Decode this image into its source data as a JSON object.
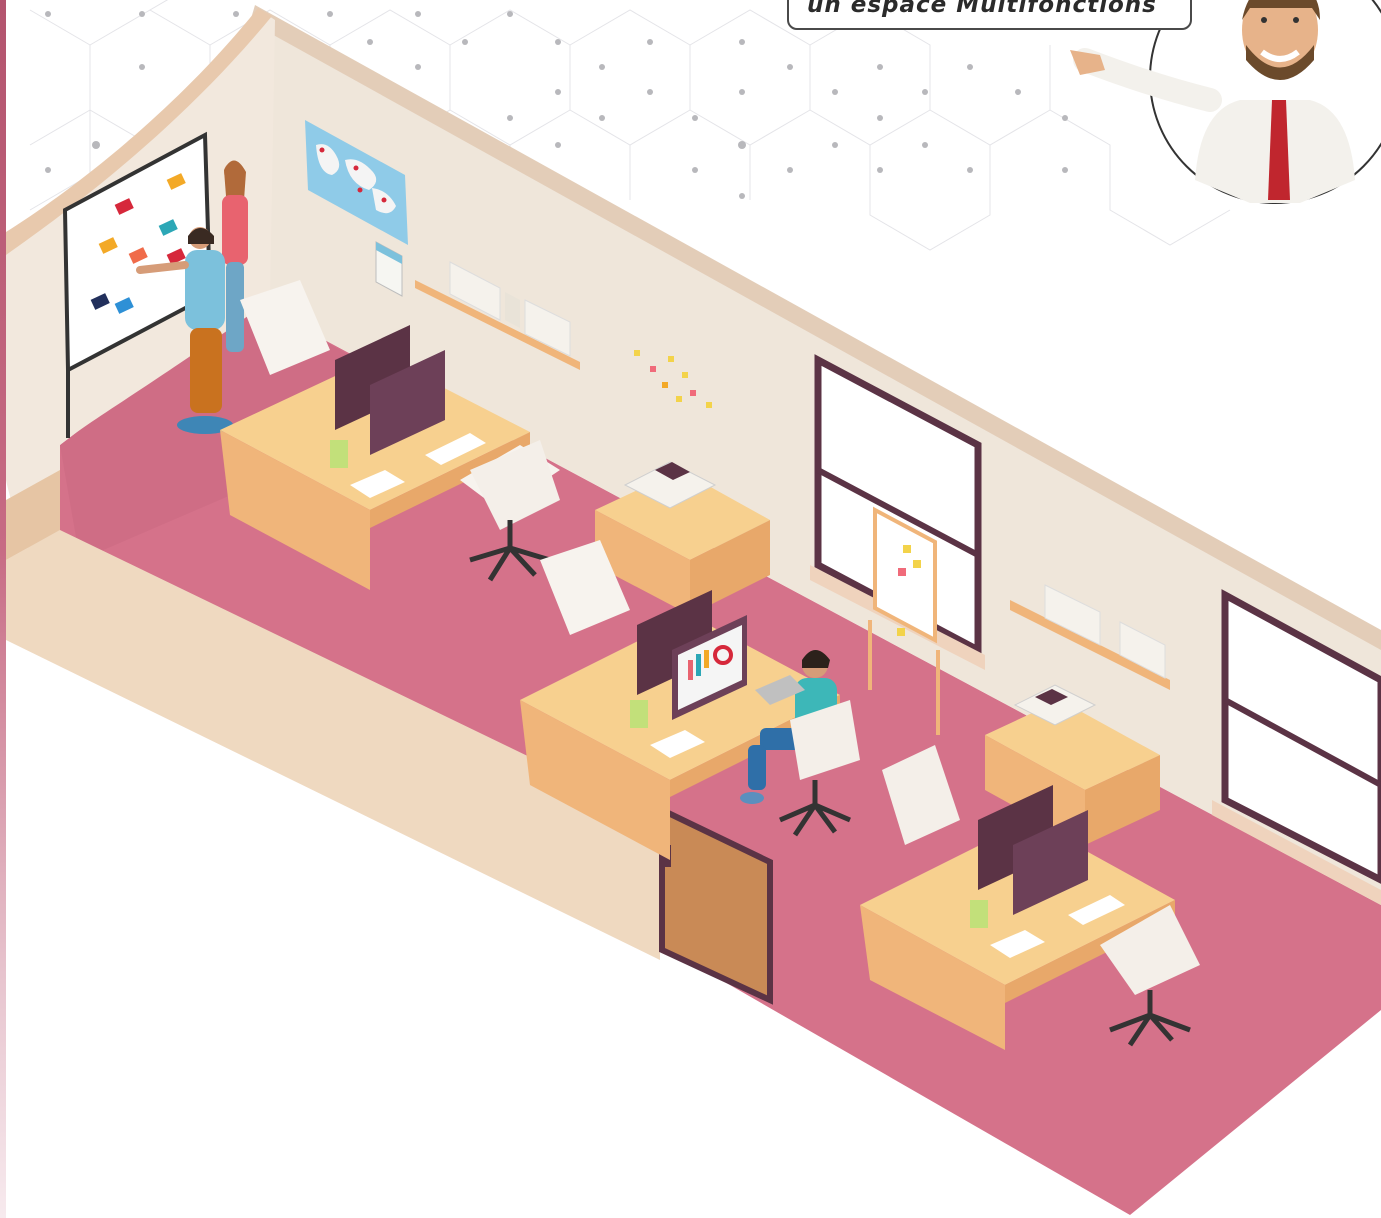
{
  "speech_bubble": {
    "text": "un espace Multifonctions"
  },
  "colors": {
    "floor": "#d5728a",
    "floor_shadow": "#b9566f",
    "wall": "#efe6da",
    "wall_edge": "#e3cdb8",
    "desk_top": "#f7d08f",
    "desk_body": "#f0b57a",
    "monitor": "#5b3345",
    "accent_red": "#c0262e",
    "left_strip": "#b3546e"
  },
  "icons": [
    "presenter-avatar",
    "world-map",
    "whiteboard",
    "sticky-notes",
    "printer",
    "office-chair",
    "computer-monitor",
    "bookshelf",
    "plant-pot",
    "window",
    "door"
  ]
}
